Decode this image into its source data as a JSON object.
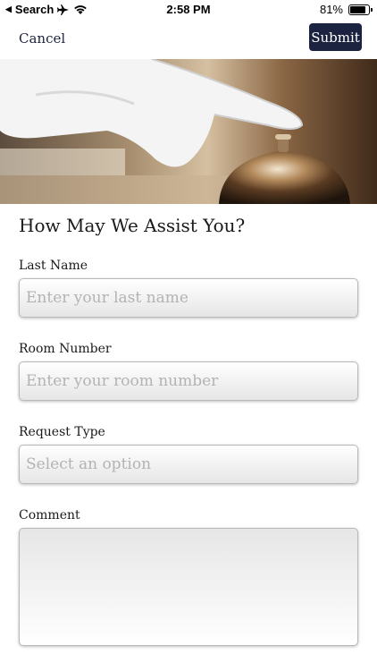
{
  "status_bar": {
    "back_label": "Search",
    "time": "2:58 PM",
    "battery": "81%",
    "battery_level": 0.81
  },
  "nav": {
    "cancel_label": "Cancel",
    "submit_label": "Submit"
  },
  "form": {
    "title": "How May We Assist You?",
    "last_name": {
      "label": "Last Name",
      "placeholder": "Enter your last name"
    },
    "room_number": {
      "label": "Room Number",
      "placeholder": "Enter your room number"
    },
    "request_type": {
      "label": "Request Type",
      "placeholder": "Select an option"
    },
    "comment": {
      "label": "Comment"
    }
  },
  "colors": {
    "accent": "#1c2340",
    "placeholder": "#b3b3b3"
  }
}
